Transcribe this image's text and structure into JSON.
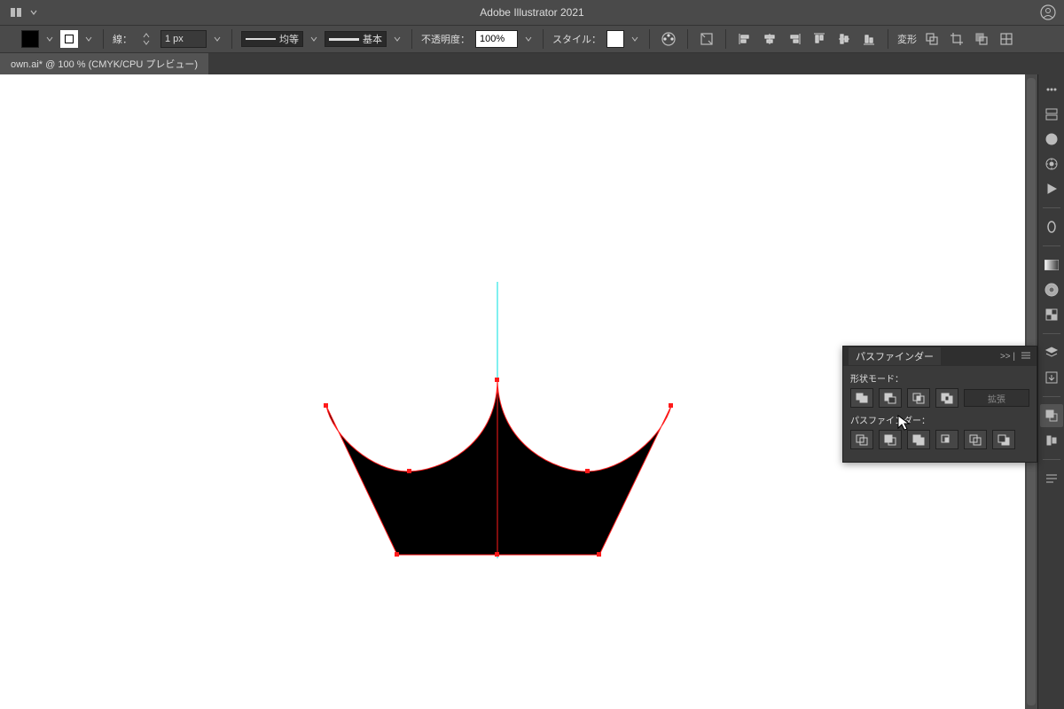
{
  "app_title": "Adobe Illustrator 2021",
  "controlbar": {
    "stroke_label": "線：",
    "stroke_weight": "1 px",
    "uniform_label": "均等",
    "brush_label": "基本",
    "opacity_label": "不透明度：",
    "opacity_value": "100%",
    "style_label": "スタイル：",
    "transform_label": "変形"
  },
  "tab": {
    "label": "own.ai* @ 100 % (CMYK/CPU プレビュー)"
  },
  "pathfinder": {
    "title": "パスファインダー",
    "collapse": ">> |",
    "shape_modes_label": "形状モード：",
    "expand_label": "拡張",
    "pathfinders_label": "パスファインダー："
  }
}
